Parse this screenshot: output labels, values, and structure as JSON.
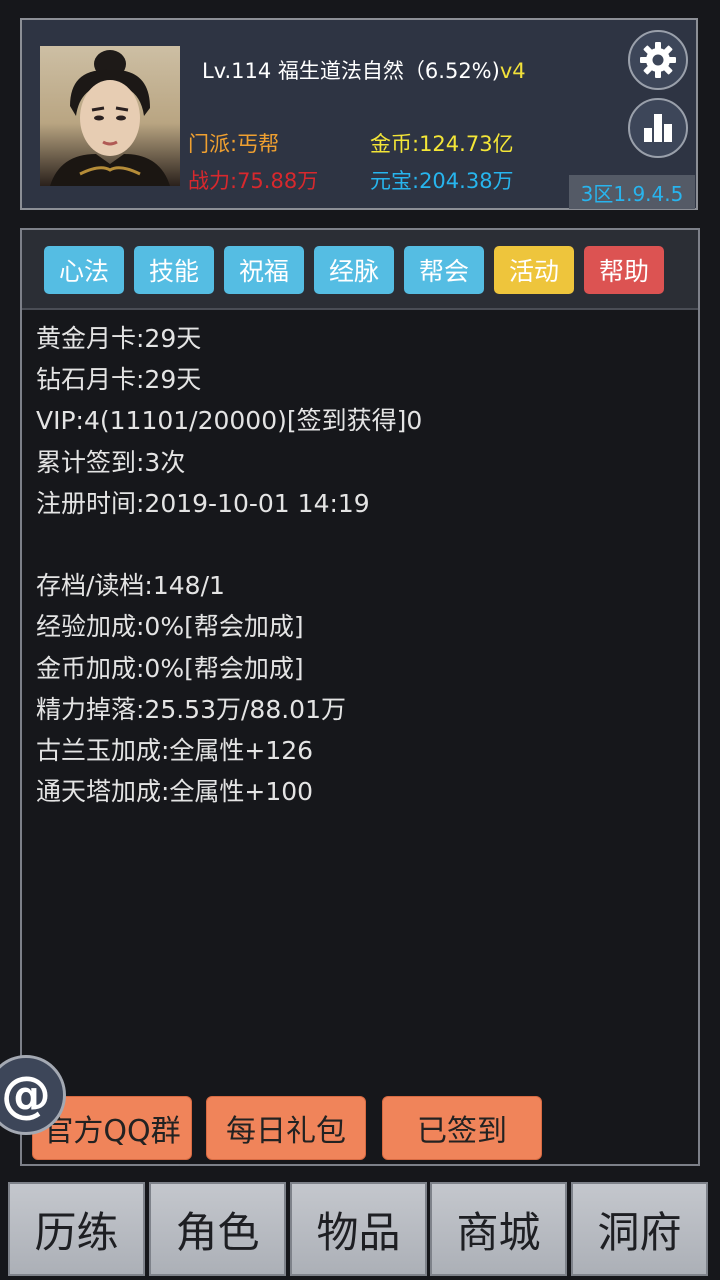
{
  "header": {
    "title_main": "Lv.114 福生道法自然（6.52%)",
    "title_version": "v4",
    "sect": "门派:丐帮",
    "power": "战力:75.88万",
    "gold": "金币:124.73亿",
    "ingot": "元宝:204.38万",
    "server_version": "3区1.9.4.5",
    "icons": {
      "settings": "gear-icon",
      "stats": "bar-chart-icon"
    }
  },
  "tabs": [
    {
      "label": "心法",
      "color": "#55bde3"
    },
    {
      "label": "技能",
      "color": "#55bde3"
    },
    {
      "label": "祝福",
      "color": "#55bde3"
    },
    {
      "label": "经脉",
      "color": "#55bde3"
    },
    {
      "label": "帮会",
      "color": "#55bde3"
    },
    {
      "label": "活动",
      "color": "#eec53c"
    },
    {
      "label": "帮助",
      "color": "#dc5352"
    }
  ],
  "info_lines": [
    "黄金月卡:29天",
    "钻石月卡:29天",
    "VIP:4(11101/20000)[签到获得]0",
    "累计签到:3次",
    "注册时间:2019-10-01 14:19",
    "",
    "存档/读档:148/1",
    "经验加成:0%[帮会加成]",
    "金币加成:0%[帮会加成]",
    "精力掉落:25.53万/88.01万",
    "古兰玉加成:全属性+126",
    "通天塔加成:全属性+100"
  ],
  "actions": {
    "qq_group": "官方QQ群",
    "daily_gift": "每日礼包",
    "signed_in": "已签到"
  },
  "floating": {
    "label": "@"
  },
  "bottom_nav": [
    "历练",
    "角色",
    "物品",
    "商城",
    "洞府"
  ]
}
